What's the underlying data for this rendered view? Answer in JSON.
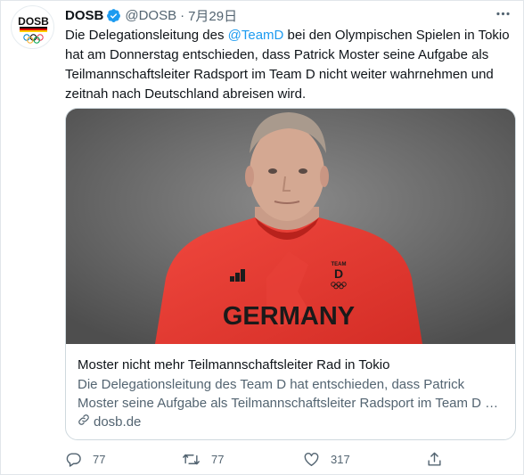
{
  "tweet": {
    "author_name": "DOSB",
    "handle": "@DOSB",
    "separator": "·",
    "date": "7月29日",
    "avatar_logo_text": "DOSB",
    "text_before": "Die Delegationsleitung des ",
    "mention": "@TeamD",
    "text_after": " bei den Olympischen Spielen in Tokio hat am Donnerstag entschieden, dass Patrick Moster seine Aufgabe als Teilmannschaftsleiter Radsport im Team D nicht weiter wahrnehmen und zeitnah nach Deutschland abreisen wird."
  },
  "card": {
    "title": "Moster nicht mehr Teilmannschaftsleiter Rad in Tokio",
    "description": "Die Delegationsleitung des Team D hat entschieden, dass Patrick Moster seine Aufgabe als Teilmannschaftsleiter Radsport im Team D …",
    "domain": "dosb.de",
    "image_jersey_text": "GERMANY",
    "image_team_letter": "D",
    "image_team_word": "TEAM"
  },
  "actions": {
    "replies": "77",
    "retweets": "77",
    "likes": "317"
  },
  "icons": [
    "more-icon",
    "verified-icon",
    "reply-icon",
    "retweet-icon",
    "like-icon",
    "share-icon",
    "link-icon"
  ],
  "colors": {
    "accent": "#1d9bf0",
    "muted": "#536471",
    "jersey": "#e8362e"
  }
}
